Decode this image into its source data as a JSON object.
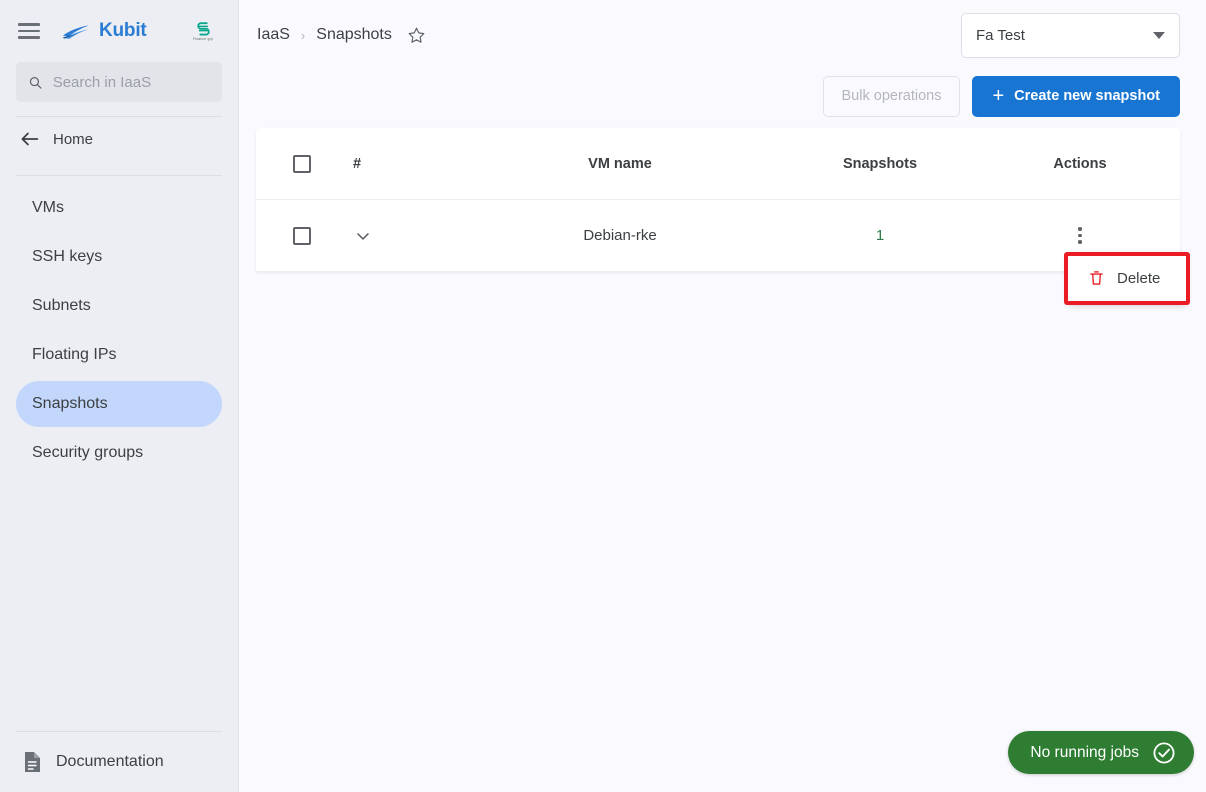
{
  "sidebar": {
    "menu_icon": "hamburger-icon",
    "brand": {
      "name": "Kubit",
      "mark": "wave-logo-icon"
    },
    "partner": {
      "mark": "s-logo-icon",
      "subtitle": "Finance grp"
    },
    "search": {
      "value": "",
      "placeholder": "Search in IaaS",
      "icon": "search-icon"
    },
    "home": {
      "label": "Home",
      "icon": "arrow-left-icon"
    },
    "items": [
      {
        "label": "VMs",
        "active": false
      },
      {
        "label": "SSH keys",
        "active": false
      },
      {
        "label": "Subnets",
        "active": false
      },
      {
        "label": "Floating IPs",
        "active": false
      },
      {
        "label": "Snapshots",
        "active": true
      },
      {
        "label": "Security groups",
        "active": false
      }
    ],
    "documentation": {
      "label": "Documentation",
      "icon": "document-icon"
    }
  },
  "header": {
    "breadcrumb": [
      "IaaS",
      "Snapshots"
    ],
    "separator": "›",
    "favorite_icon": "star-outline-icon",
    "account": {
      "value": "Fa Test",
      "icon": "chevron-down-icon"
    }
  },
  "toolbar": {
    "bulk_label": "Bulk operations",
    "create_label": "Create new snapshot",
    "create_icon": "plus-icon"
  },
  "table": {
    "columns": [
      "",
      "#",
      "VM name",
      "Snapshots",
      "Actions"
    ],
    "select_all_icon": "checkbox-unchecked-icon",
    "rows": [
      {
        "checkbox": "checkbox-unchecked-icon",
        "expand_icon": "chevron-down-icon",
        "vm_name": "Debian-rke",
        "snapshots": "1",
        "actions_icon": "more-vertical-icon"
      }
    ]
  },
  "context_menu": {
    "visible": true,
    "items": [
      {
        "label": "Delete",
        "icon": "trash-icon"
      }
    ],
    "highlight_color": "#ea1c24"
  },
  "status": {
    "jobs_label": "No running jobs",
    "jobs_icon": "check-circle-icon",
    "color": "#2e7d32"
  },
  "colors": {
    "accent_blue": "#1876d2",
    "brand_blue": "#2b7cd3",
    "nav_active": "#c2d7fb",
    "page_bg": "#fafafe",
    "sidebar_bg": "#eceef3",
    "green": "#2e7d32",
    "link_green": "#2d7d4a",
    "red": "#ea1c24"
  }
}
